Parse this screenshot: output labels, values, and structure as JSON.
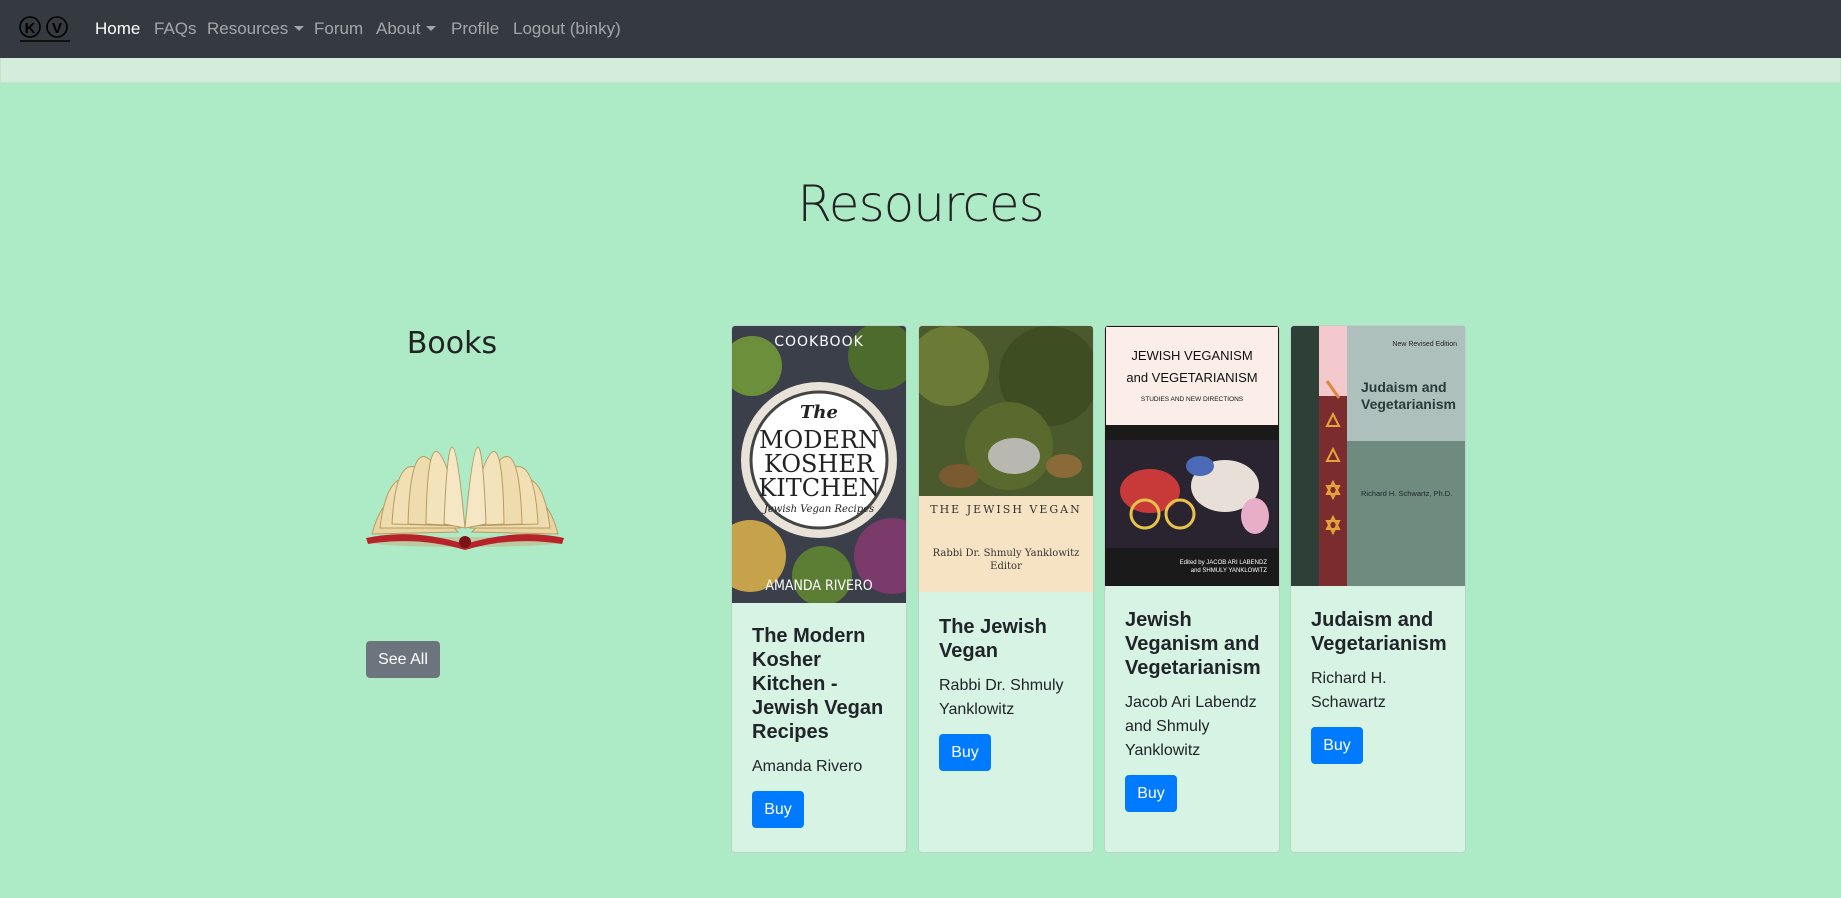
{
  "navbar": {
    "logo_letters": [
      "K",
      "V"
    ],
    "items": [
      {
        "label": "Home",
        "active": true
      },
      {
        "label": "FAQs"
      },
      {
        "label": "Resources",
        "dropdown": true
      },
      {
        "label": "Forum"
      },
      {
        "label": "About",
        "dropdown": true
      },
      {
        "label": "Profile"
      },
      {
        "label": "Logout (binky)"
      }
    ]
  },
  "page": {
    "title": "Resources"
  },
  "books_section": {
    "title": "Books",
    "see_all_label": "See All"
  },
  "books": [
    {
      "title": "The Modern Kosher Kitchen - Jewish Vegan Recipes",
      "author": "Amanda Rivero",
      "buy_label": "Buy",
      "cover": {
        "top": "COOKBOOK",
        "line1": "The",
        "line2": "MODERN",
        "line3": "KOSHER",
        "line4": "KITCHEN",
        "subtitle": "Jewish Vegan Recipes",
        "author": "AMANDA RIVERO"
      }
    },
    {
      "title": "The Jewish Vegan",
      "author": "Rabbi Dr. Shmuly Yanklowitz",
      "buy_label": "Buy",
      "cover": {
        "title": "THE JEWISH VEGAN",
        "byline1": "Rabbi Dr. Shmuly Yanklowitz",
        "byline2": "Editor"
      }
    },
    {
      "title": "Jewish Veganism and Vegetarianism",
      "author": "Jacob Ari Labendz and Shmuly Yanklowitz",
      "buy_label": "Buy",
      "cover": {
        "title1": "JEWISH VEGANISM",
        "title2": "and VEGETARIANISM",
        "subtitle": "STUDIES AND NEW DIRECTIONS",
        "editors1": "Edited by JACOB ARI LABENDZ",
        "editors2": "and SHMULY YANKLOWITZ"
      }
    },
    {
      "title": "Judaism and Vegetarianism",
      "author": "Richard H. Schawartz",
      "buy_label": "Buy",
      "cover": {
        "edition": "New Revised Edition",
        "title1": "Judaism and",
        "title2": "Vegetarianism",
        "author": "Richard H. Schwartz, Ph.D."
      }
    }
  ],
  "colors": {
    "page_bg": "#adebc7",
    "navbar_bg": "#343a40",
    "primary": "#007bff",
    "secondary": "#6c757d",
    "card_bg": "#d6f3e3"
  }
}
